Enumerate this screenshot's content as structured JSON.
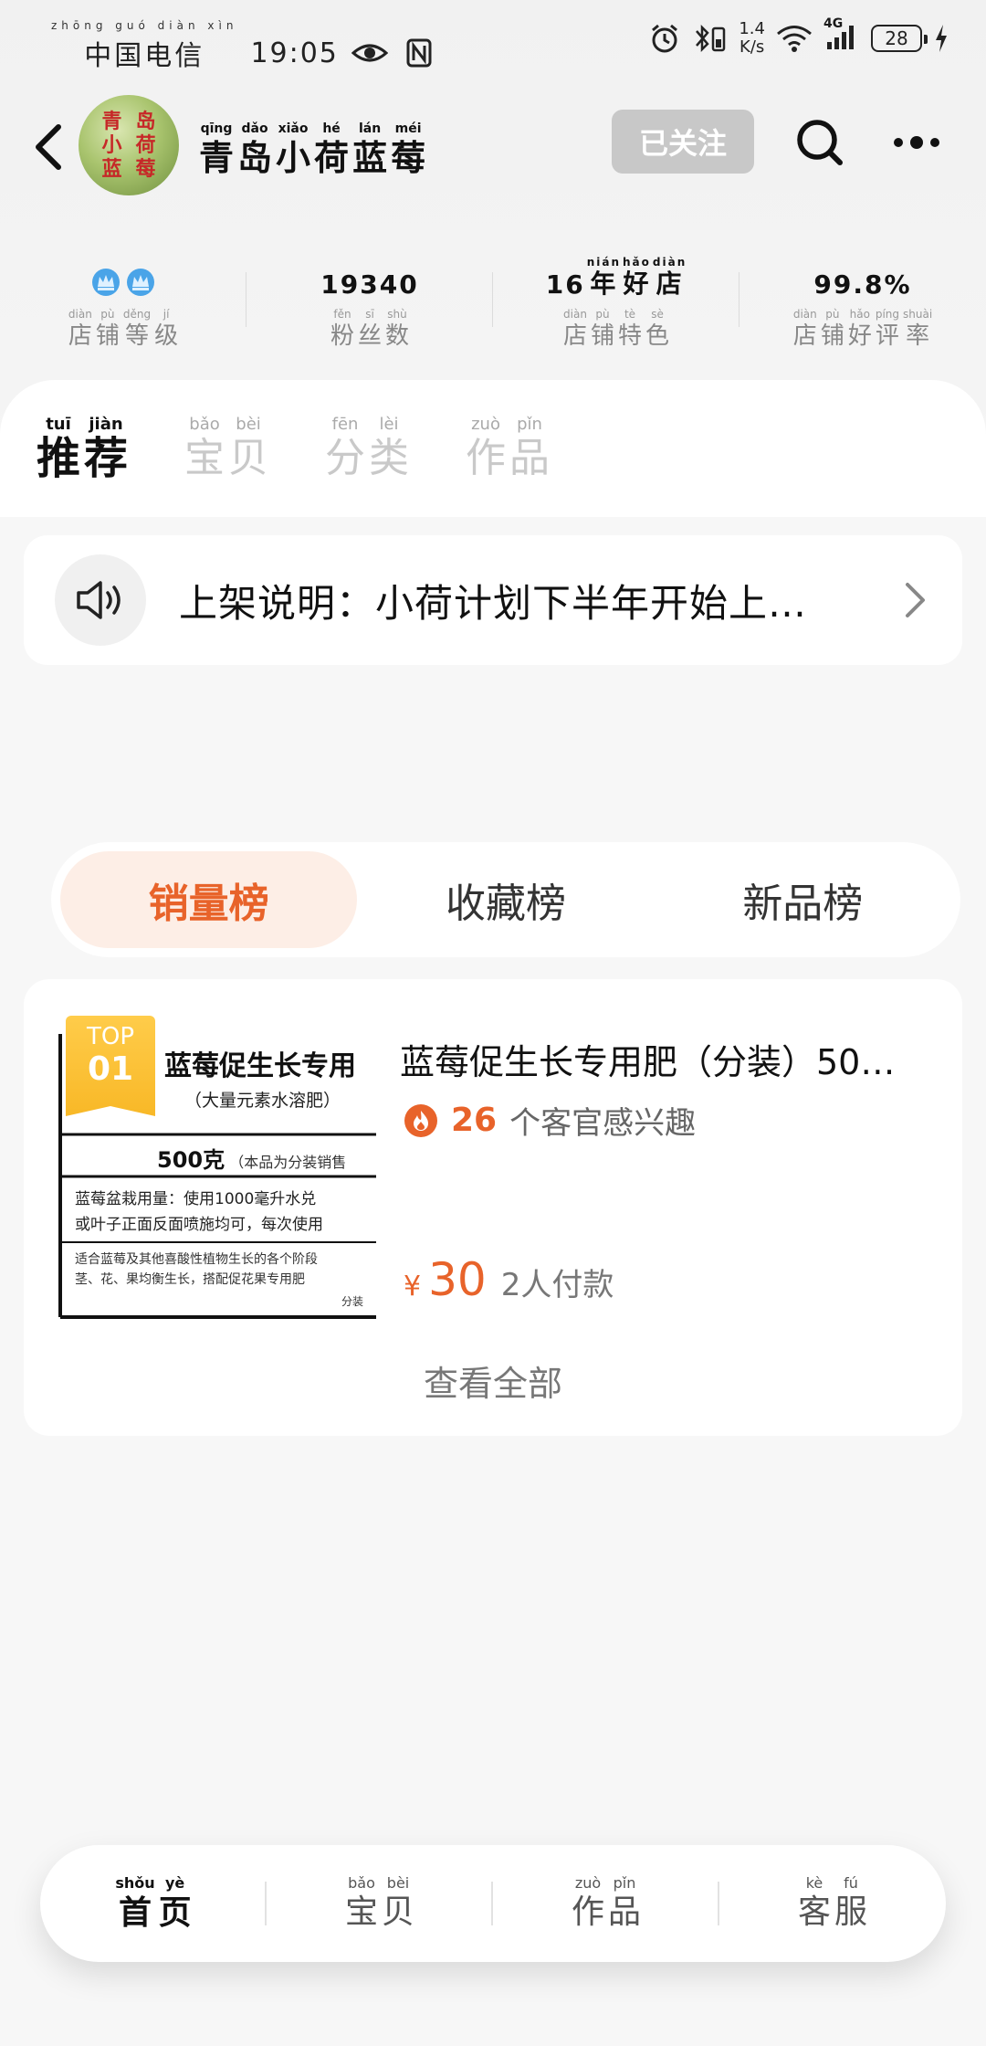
{
  "status_bar": {
    "carrier_pinyin": "zhōng guó diàn xìn",
    "carrier": "中国电信",
    "time": "19:05",
    "net_speed_value": "1.4",
    "net_speed_unit": "K/s",
    "network_type": "4G",
    "battery": "28"
  },
  "header": {
    "logo_text": [
      "青",
      "岛",
      "小",
      "荷",
      "蓝",
      "莓"
    ],
    "shop_name": [
      {
        "py": "qīng",
        "hz": "青"
      },
      {
        "py": "dǎo",
        "hz": "岛"
      },
      {
        "py": "xiǎo",
        "hz": "小"
      },
      {
        "py": "hé",
        "hz": "荷"
      },
      {
        "py": "lán",
        "hz": "蓝"
      },
      {
        "py": "méi",
        "hz": "莓"
      }
    ],
    "follow_label": "已关注"
  },
  "stats": {
    "level_label": [
      {
        "py": "diàn",
        "hz": "店"
      },
      {
        "py": "pù",
        "hz": "铺"
      },
      {
        "py": "děng",
        "hz": "等"
      },
      {
        "py": "jí",
        "hz": "级"
      }
    ],
    "fans_value": "19340",
    "fans_label": [
      {
        "py": "fěn",
        "hz": "粉"
      },
      {
        "py": "sī",
        "hz": "丝"
      },
      {
        "py": "shù",
        "hz": "数"
      }
    ],
    "feature_value_prefix": "16",
    "feature_value": [
      {
        "py": "nián",
        "hz": "年"
      },
      {
        "py": "hǎo",
        "hz": "好"
      },
      {
        "py": "diàn",
        "hz": "店"
      }
    ],
    "feature_label": [
      {
        "py": "diàn",
        "hz": "店"
      },
      {
        "py": "pù",
        "hz": "铺"
      },
      {
        "py": "tè",
        "hz": "特"
      },
      {
        "py": "sè",
        "hz": "色"
      }
    ],
    "rating_value": "99.8%",
    "rating_label": [
      {
        "py": "diàn",
        "hz": "店"
      },
      {
        "py": "pù",
        "hz": "铺"
      },
      {
        "py": "hǎo",
        "hz": "好"
      },
      {
        "py": "píng",
        "hz": "评"
      },
      {
        "py": "shuài",
        "hz": "率"
      }
    ]
  },
  "tabs": [
    {
      "chars": [
        {
          "py": "tuī",
          "hz": "推"
        },
        {
          "py": "jiàn",
          "hz": "荐"
        }
      ]
    },
    {
      "chars": [
        {
          "py": "bǎo",
          "hz": "宝"
        },
        {
          "py": "bèi",
          "hz": "贝"
        }
      ]
    },
    {
      "chars": [
        {
          "py": "fēn",
          "hz": "分"
        },
        {
          "py": "lèi",
          "hz": "类"
        }
      ]
    },
    {
      "chars": [
        {
          "py": "zuò",
          "hz": "作"
        },
        {
          "py": "pǐn",
          "hz": "品"
        }
      ]
    }
  ],
  "notice": {
    "text": "上架说明：小荷计划下半年开始上…"
  },
  "rank_tabs": [
    "销量榜",
    "收藏榜",
    "新品榜"
  ],
  "product": {
    "badge_top": "TOP",
    "badge_rank": "01",
    "thumb_title": "蓝莓促生长专用",
    "thumb_sub": "（大量元素水溶肥）",
    "thumb_weight": "500克",
    "thumb_weight_note": "（本品为分装销售",
    "thumb_line1": "蓝莓盆栽用量：使用1000毫升水兑",
    "thumb_line2": "或叶子正面反面喷施均可，每次使用",
    "thumb_line3": "适合蓝莓及其他喜酸性植物生长的各个阶段",
    "thumb_line4": "茎、花、果均衡生长，搭配促花果专用肥",
    "thumb_line5": "分装",
    "title": "蓝莓促生长专用肥（分装）50…",
    "interest_count": "26",
    "interest_text": "个客官感兴趣",
    "price_symbol": "¥",
    "price": "30",
    "paid": "2人付款"
  },
  "view_all": "查看全部",
  "bottom_nav": [
    {
      "chars": [
        {
          "py": "shǒu",
          "hz": "首"
        },
        {
          "py": "yè",
          "hz": "页"
        }
      ]
    },
    {
      "chars": [
        {
          "py": "bǎo",
          "hz": "宝"
        },
        {
          "py": "bèi",
          "hz": "贝"
        }
      ]
    },
    {
      "chars": [
        {
          "py": "zuò",
          "hz": "作"
        },
        {
          "py": "pǐn",
          "hz": "品"
        }
      ]
    },
    {
      "chars": [
        {
          "py": "kè",
          "hz": "客"
        },
        {
          "py": "fú",
          "hz": "服"
        }
      ]
    }
  ],
  "colors": {
    "accent": "#e8632a",
    "accent_bg": "#fdeee6",
    "badge": "#f8b827",
    "follow_bg": "#c8c8c8"
  }
}
